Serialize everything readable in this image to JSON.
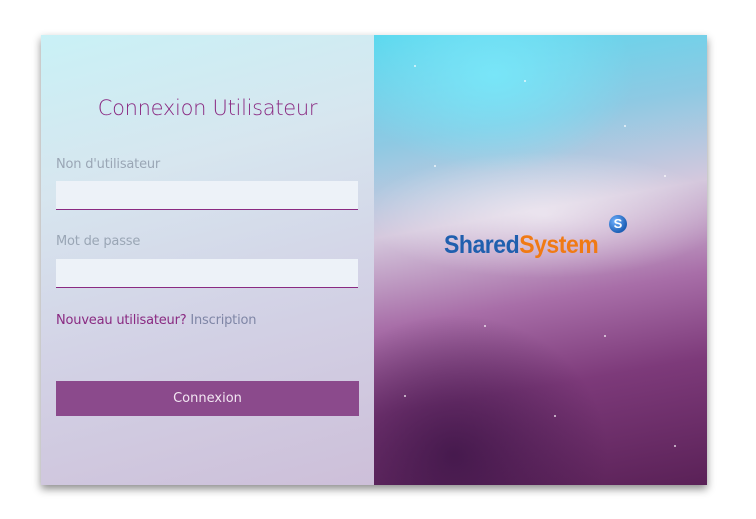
{
  "login": {
    "title": "Connexion Utilisateur",
    "username_label": "Non d'utilisateur",
    "username_value": "",
    "password_label": "Mot de passe",
    "password_value": "",
    "register_question": "Nouveau utilisateur?",
    "register_link": "Inscription",
    "submit_label": "Connexion"
  },
  "brand": {
    "logo_part1": "Shared",
    "logo_part2": "System",
    "logo_mark": "S"
  },
  "colors": {
    "accent": "#8a2a82",
    "button": "#8b4a8c",
    "logo_blue": "#1f5fae",
    "logo_orange": "#f07a14"
  }
}
